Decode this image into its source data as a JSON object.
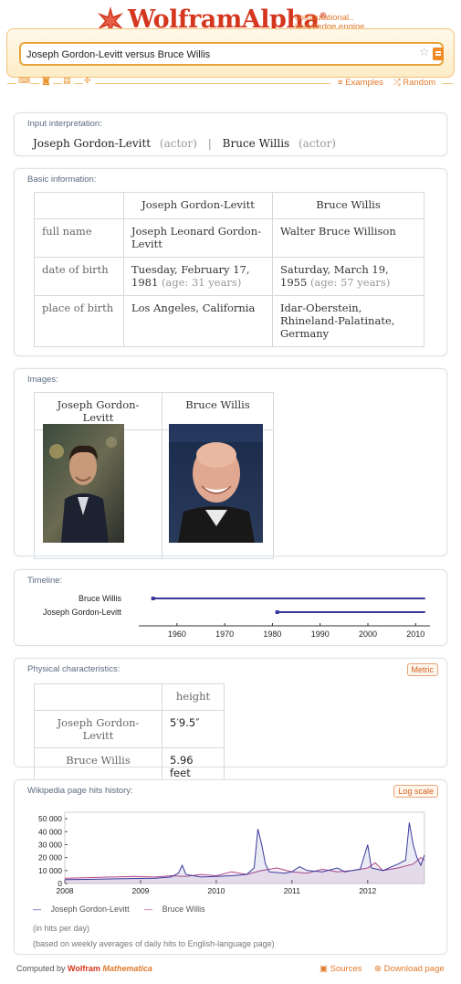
{
  "header": {
    "logo_text": "WolframAlpha",
    "trademark": "®",
    "tagline_line1": "computational..",
    "tagline_line2": "knowledge engine"
  },
  "search": {
    "value": "Joseph Gordon-Levitt versus Bruce Willis"
  },
  "nav": {
    "examples_label": "Examples",
    "random_label": "Random"
  },
  "input_interpretation": {
    "title": "Input interpretation:",
    "person1": "Joseph Gordon-Levitt",
    "person1_type": "(actor)",
    "separator": "|",
    "person2": "Bruce Willis",
    "person2_type": "(actor)"
  },
  "basic_info": {
    "title": "Basic information:",
    "headers": [
      "Joseph Gordon-Levitt",
      "Bruce Willis"
    ],
    "rows": [
      {
        "label": "full name",
        "a": "Joseph Leonard Gordon-Levitt",
        "a_note": "",
        "b": "Walter Bruce Willison",
        "b_note": ""
      },
      {
        "label": "date of birth",
        "a": "Tuesday, February 17, 1981",
        "a_note": "(age: 31 years)",
        "b": "Saturday, March 19, 1955",
        "b_note": "(age: 57 years)"
      },
      {
        "label": "place of birth",
        "a": "Los Angeles, California",
        "a_note": "",
        "b": "Idar-Oberstein, Rhineland-Palatinate, Germany",
        "b_note": ""
      }
    ]
  },
  "images": {
    "title": "Images:",
    "headers": [
      "Joseph Gordon-Levitt",
      "Bruce Willis"
    ]
  },
  "timeline": {
    "title": "Timeline:",
    "chart_data": {
      "type": "timeline",
      "series": [
        {
          "name": "Bruce Willis",
          "start": 1955,
          "end": 2012
        },
        {
          "name": "Joseph Gordon-Levitt",
          "start": 1981,
          "end": 2012
        }
      ],
      "xlim": [
        1952,
        2013
      ],
      "ticks": [
        1960,
        1970,
        1980,
        1990,
        2000,
        2010
      ],
      "color": "#3a3a9e"
    }
  },
  "physical": {
    "title": "Physical characteristics:",
    "button": "Metric",
    "header": "height",
    "rows": [
      {
        "label": "Joseph Gordon-Levitt",
        "value": "5′9.5″"
      },
      {
        "label": "Bruce Willis",
        "value": "5.96 feet"
      }
    ]
  },
  "wiki": {
    "title": "Wikipedia page hits history:",
    "button": "Log scale",
    "legend": [
      "Joseph Gordon-Levitt",
      "Bruce Willis"
    ],
    "note1": "(in hits per day)",
    "note2": "(based on weekly averages of daily hits to English-language page)",
    "chart_data": {
      "type": "line",
      "ylim": [
        0,
        55000
      ],
      "yticks": [
        0,
        10000,
        20000,
        30000,
        40000,
        50000
      ],
      "ytick_labels": [
        "0",
        "10 000",
        "20 000",
        "30 000",
        "40 000",
        "50 000"
      ],
      "xticks": [
        "2008",
        "2009",
        "2010",
        "2011",
        "2012"
      ],
      "xlim": [
        2008.0,
        2012.75
      ],
      "series": [
        {
          "name": "Joseph Gordon-Levitt",
          "color": "#3a3a9e",
          "points": [
            [
              2008.0,
              3000
            ],
            [
              2008.3,
              3200
            ],
            [
              2008.6,
              3500
            ],
            [
              2008.9,
              3800
            ],
            [
              2009.2,
              4000
            ],
            [
              2009.4,
              5000
            ],
            [
              2009.5,
              8000
            ],
            [
              2009.55,
              14000
            ],
            [
              2009.6,
              7000
            ],
            [
              2009.8,
              5000
            ],
            [
              2010.0,
              5500
            ],
            [
              2010.2,
              6000
            ],
            [
              2010.4,
              7000
            ],
            [
              2010.5,
              12000
            ],
            [
              2010.55,
              42000
            ],
            [
              2010.6,
              30000
            ],
            [
              2010.65,
              15000
            ],
            [
              2010.7,
              9000
            ],
            [
              2010.9,
              8000
            ],
            [
              2011.0,
              9000
            ],
            [
              2011.1,
              13000
            ],
            [
              2011.2,
              10000
            ],
            [
              2011.4,
              9000
            ],
            [
              2011.6,
              12000
            ],
            [
              2011.7,
              9000
            ],
            [
              2011.9,
              11000
            ],
            [
              2012.0,
              30000
            ],
            [
              2012.05,
              12000
            ],
            [
              2012.2,
              10000
            ],
            [
              2012.4,
              15000
            ],
            [
              2012.5,
              18000
            ],
            [
              2012.55,
              47000
            ],
            [
              2012.6,
              30000
            ],
            [
              2012.65,
              20000
            ],
            [
              2012.7,
              14000
            ],
            [
              2012.75,
              22000
            ]
          ]
        },
        {
          "name": "Bruce Willis",
          "color": "#b04a8a",
          "points": [
            [
              2008.0,
              4000
            ],
            [
              2008.3,
              4500
            ],
            [
              2008.6,
              5000
            ],
            [
              2008.9,
              5500
            ],
            [
              2009.2,
              5000
            ],
            [
              2009.4,
              6000
            ],
            [
              2009.6,
              5500
            ],
            [
              2009.8,
              7000
            ],
            [
              2010.0,
              6000
            ],
            [
              2010.2,
              9000
            ],
            [
              2010.4,
              7000
            ],
            [
              2010.6,
              10000
            ],
            [
              2010.8,
              12000
            ],
            [
              2011.0,
              9000
            ],
            [
              2011.2,
              8000
            ],
            [
              2011.4,
              11000
            ],
            [
              2011.6,
              9000
            ],
            [
              2011.8,
              10000
            ],
            [
              2012.0,
              12000
            ],
            [
              2012.1,
              16000
            ],
            [
              2012.2,
              10000
            ],
            [
              2012.4,
              12000
            ],
            [
              2012.6,
              15000
            ],
            [
              2012.7,
              20000
            ],
            [
              2012.75,
              18000
            ]
          ]
        }
      ]
    }
  },
  "footer": {
    "computed_by": "Computed by",
    "brand1": "Wolfram",
    "brand2": "Mathematica",
    "sources_label": "Sources",
    "download_label": "Download page"
  }
}
